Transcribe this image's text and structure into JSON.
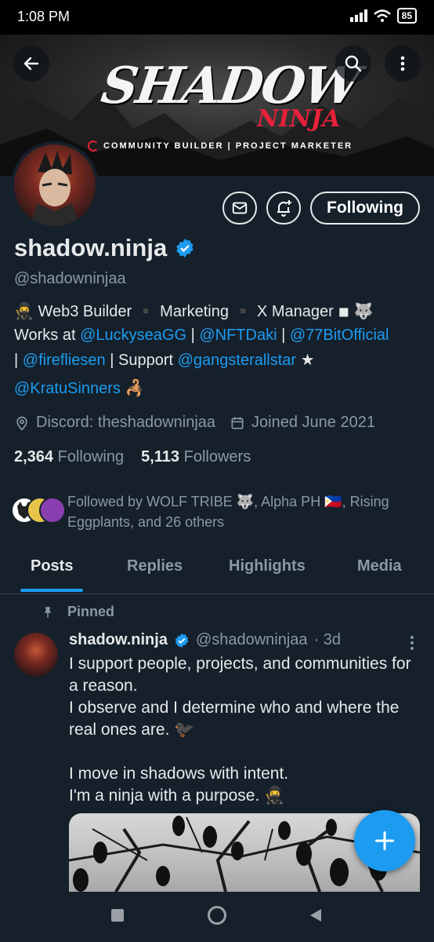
{
  "status_bar": {
    "time": "1:08 PM",
    "battery": "85"
  },
  "banner": {
    "title": "SHADOW",
    "subtitle": "NINJA",
    "tagline": "COMMUNITY BUILDER | PROJECT MARKETER"
  },
  "profile": {
    "name": "shadow.ninja",
    "handle": "@shadowninjaa",
    "follow_button": "Following",
    "bio": {
      "line1_emoji": "🥷",
      "line1": " Web3 Builder ▪️ Marketing ▪️ X Manager ◾ 🐺",
      "works_at": "Works at ",
      "link1": "@LuckyseaGG",
      "sep1": " | ",
      "link2": "@NFTDaki",
      "sep2": " | ",
      "link3": "@77BitOfficial",
      "sep3": "| ",
      "link4": "@firefliesen",
      "support": " | Support ",
      "link5": "@gangsterallstar",
      "star": " ★",
      "link6": "@KratuSinners",
      "line_end": " 🦂"
    },
    "location": "Discord: theshadowninjaa",
    "joined": "Joined June 2021",
    "following_count": "2,364",
    "following_label": "Following",
    "followers_count": "5,113",
    "followers_label": "Followers",
    "followed_by": "Followed by WOLF TRIBE 🐺, Alpha PH 🇵🇭, Rising Eggplants, and 26 others"
  },
  "tabs": [
    "Posts",
    "Replies",
    "Highlights",
    "Media"
  ],
  "post": {
    "pinned_label": "Pinned",
    "author": "shadow.ninja",
    "handle": "@shadowninjaa",
    "time": "· 3d",
    "text": "I support people, projects, and communities for a reason.\nI observe and I determine who and where the real ones are. 🐦‍⬛\n\nI move in shadows with intent.\nI'm a ninja with a purpose. 🥷"
  },
  "colors": {
    "accent": "#1d9bf0",
    "background": "#15202b",
    "banner_red": "#e8213a"
  }
}
